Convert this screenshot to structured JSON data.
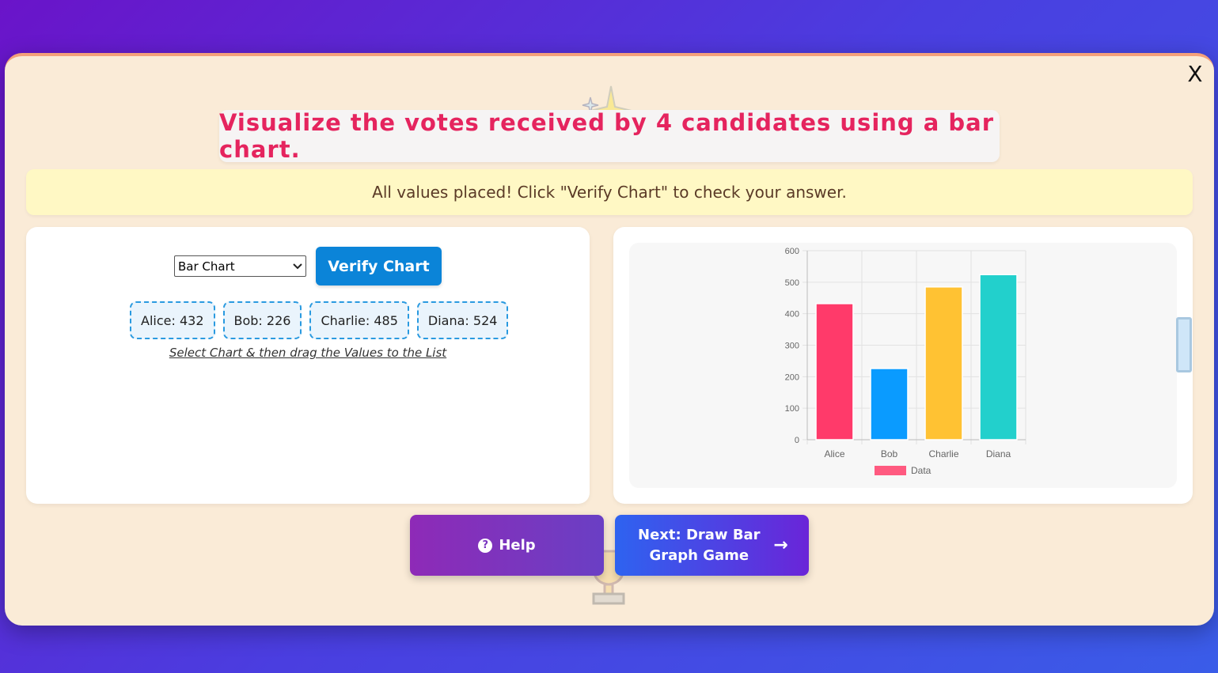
{
  "modal": {
    "close_label": "X",
    "title": "Visualize the votes received by 4 candidates using a bar chart.",
    "feedback": "All values placed! Click \"Verify Chart\" to check your answer."
  },
  "controls": {
    "chart_type_selected": "Bar Chart",
    "verify_label": "Verify Chart",
    "instruction": "Select Chart & then drag the Values to the List"
  },
  "values": [
    {
      "label": "Alice: 432"
    },
    {
      "label": "Bob: 226"
    },
    {
      "label": "Charlie: 485"
    },
    {
      "label": "Diana: 524"
    }
  ],
  "buttons": {
    "help_label": "Help",
    "next_label": "Next: Draw Bar Graph Game",
    "next_arrow": "→"
  },
  "icons": {
    "help": "question-circle-icon",
    "next": "arrow-right-icon",
    "close": "close-icon",
    "select": "chevron-down-icon"
  },
  "chart_data": {
    "type": "bar",
    "categories": [
      "Alice",
      "Bob",
      "Charlie",
      "Diana"
    ],
    "series": [
      {
        "name": "Data",
        "values": [
          432,
          226,
          485,
          524
        ]
      }
    ],
    "colors": [
      "#ff3a6a",
      "#0a9bff",
      "#ffc233",
      "#22d0cc"
    ],
    "legend_swatch_color": "#ff5a80",
    "yticks": [
      0,
      100,
      200,
      300,
      400,
      500,
      600
    ],
    "ylim": [
      0,
      600
    ],
    "grid": true,
    "legend": "bottom",
    "title": "",
    "xlabel": "",
    "ylabel": ""
  }
}
